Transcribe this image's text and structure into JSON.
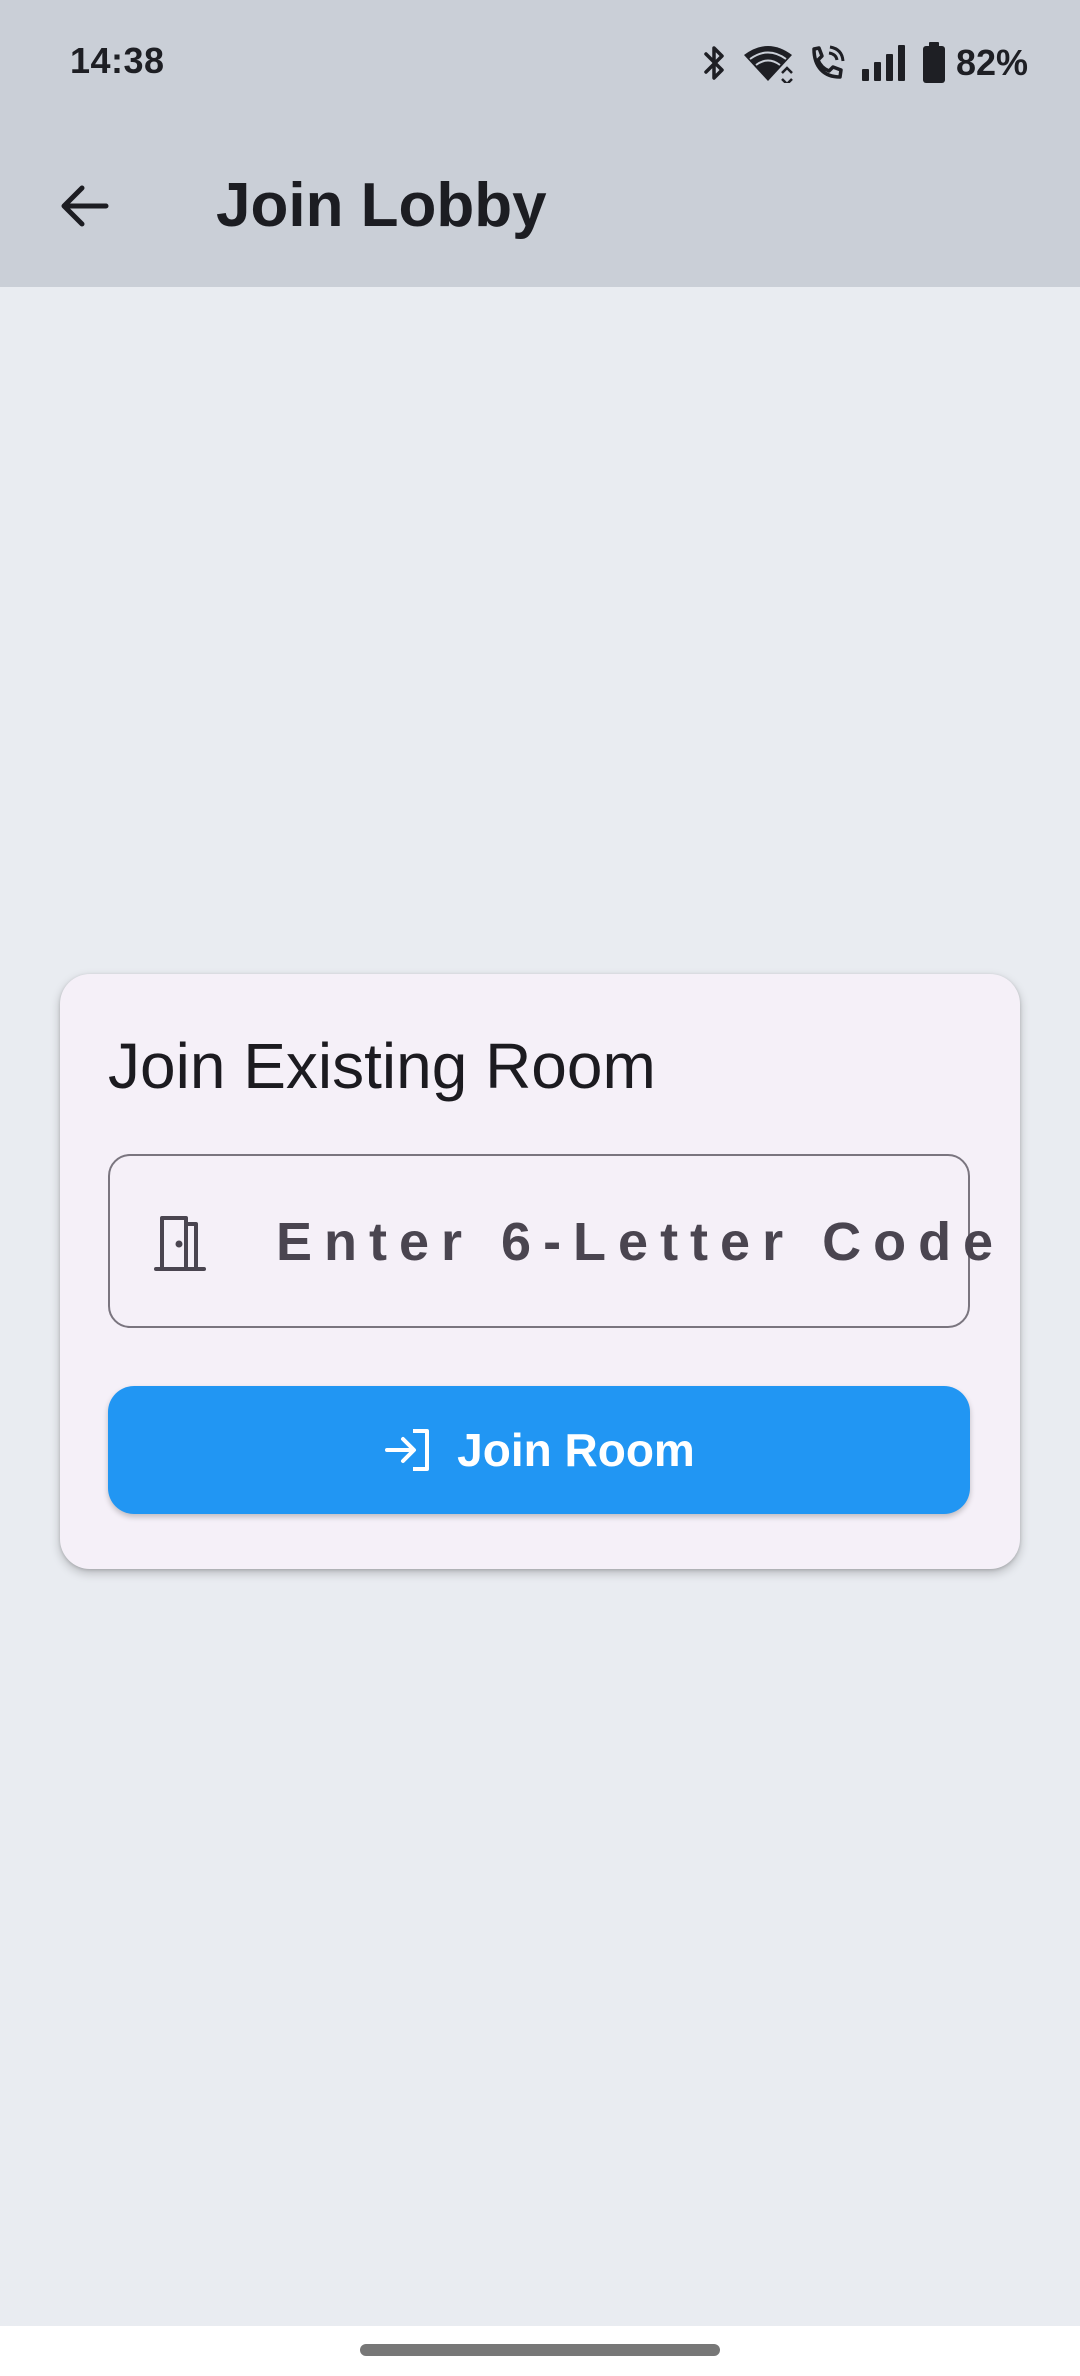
{
  "status_bar": {
    "time": "14:38",
    "battery_percent": "82%",
    "icons": [
      "bluetooth-icon",
      "wifi-icon",
      "wifi-calling-icon",
      "signal-icon",
      "battery-icon"
    ]
  },
  "app_bar": {
    "title": "Join Lobby",
    "back_icon": "arrow-back-icon"
  },
  "card": {
    "title": "Join Existing Room",
    "code_input": {
      "placeholder": "Enter 6-Letter Code",
      "value": "",
      "icon": "door-icon"
    },
    "join_button": {
      "label": "Join Room",
      "icon": "login-icon"
    }
  },
  "colors": {
    "top_bar_bg": "#cacfd7",
    "page_bg": "#e9ecf1",
    "card_bg": "#f5f0f8",
    "primary": "#2196f3"
  }
}
